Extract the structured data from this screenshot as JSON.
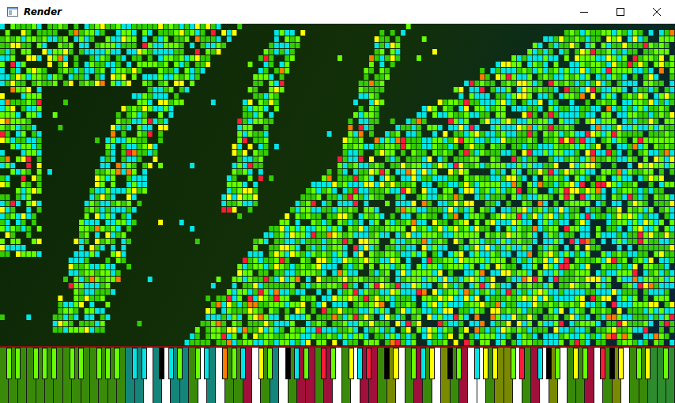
{
  "window": {
    "title": "Render"
  },
  "tracks": [
    {
      "color": "#00e6e6",
      "share": 0.3
    },
    {
      "color": "#33cc00",
      "share": 0.3
    },
    {
      "color": "#66ff00",
      "share": 0.25
    },
    {
      "color": "#ffff00",
      "share": 0.1
    },
    {
      "color": "#ff1a3a",
      "share": 0.03
    },
    {
      "color": "#ff7a00",
      "share": 0.02
    }
  ],
  "keyboard": {
    "white_keys": [
      "#3a8a0a",
      "#3a8a0a",
      "#3a8a0a",
      "#3a8a0a",
      "#3a8a0a",
      "#3a8a0a",
      "#3a8a0a",
      "#3a8a0a",
      "#3a8a0a",
      "#3a8a0a",
      "#3a8a0a",
      "#3a8a0a",
      "#3a8a0a",
      "#3a8a0a",
      "#14857a",
      "#14857a",
      "#ffffff",
      "#14857a",
      "#ffffff",
      "#14857a",
      "#14857a",
      "#3a8a0a",
      "#ffffff",
      "#14857a",
      "#ffffff",
      "#3a8a0a",
      "#3a8a0a",
      "#a0103a",
      "#ffffff",
      "#3a8a0a",
      "#14857a",
      "#ffffff",
      "#3a8a0a",
      "#a0103a",
      "#a0103a",
      "#3a8a0a",
      "#a0103a",
      "#ffffff",
      "#3a8a0a",
      "#ffffff",
      "#a0103a",
      "#a0103a",
      "#3a8a0a",
      "#7a8a00",
      "#ffffff",
      "#3a8a0a",
      "#a0103a",
      "#3a8a0a",
      "#ffffff",
      "#7a8a00",
      "#3a8a0a",
      "#a0103a",
      "#ffffff",
      "#ffffff",
      "#3a8a0a",
      "#7a8a00",
      "#7a8a00",
      "#ffffff",
      "#3a8a0a",
      "#a0103a",
      "#ffffff",
      "#7a8a00",
      "#ffffff",
      "#3a8a0a",
      "#3a8a0a",
      "#a0103a",
      "#ffffff",
      "#3a8a0a",
      "#7a8a00",
      "#ffffff",
      "#3a8a0a",
      "#3a8a0a",
      "#2e8b2e",
      "#2e8b2e",
      "#2e8b2e"
    ],
    "black_keys": [
      "#66ff00",
      "#66ff00",
      "#66ff00",
      "#66ff00",
      "#66ff00",
      "#66ff00",
      "#66ff00",
      "#66ff00",
      "#66ff00",
      "#66ff00",
      "#00e6e6",
      "#00e6e6",
      "#000000",
      "#00e6e6",
      "#66ff00",
      "#66ff00",
      "#00e6e6",
      "#ff7a00",
      "#66ff00",
      "#00e6e6",
      "#ffff00",
      "#66ff00",
      "#000000",
      "#00e6e6",
      "#66ff00",
      "#ff1a3a",
      "#66ff00",
      "#ffff00",
      "#00e6e6",
      "#ff1a3a",
      "#000000",
      "#ffff00",
      "#66ff00",
      "#00e6e6",
      "#ffff00",
      "#000000",
      "#66ff00",
      "#00e6e6",
      "#ffff00",
      "#ffff00",
      "#66ff00",
      "#ff1a3a",
      "#00e6e6",
      "#000000",
      "#66ff00",
      "#ffff00",
      "#66ff00",
      "#ff1a3a",
      "#000000",
      "#ffff00",
      "#66ff00",
      "#ffff00",
      "#66ff00"
    ]
  }
}
